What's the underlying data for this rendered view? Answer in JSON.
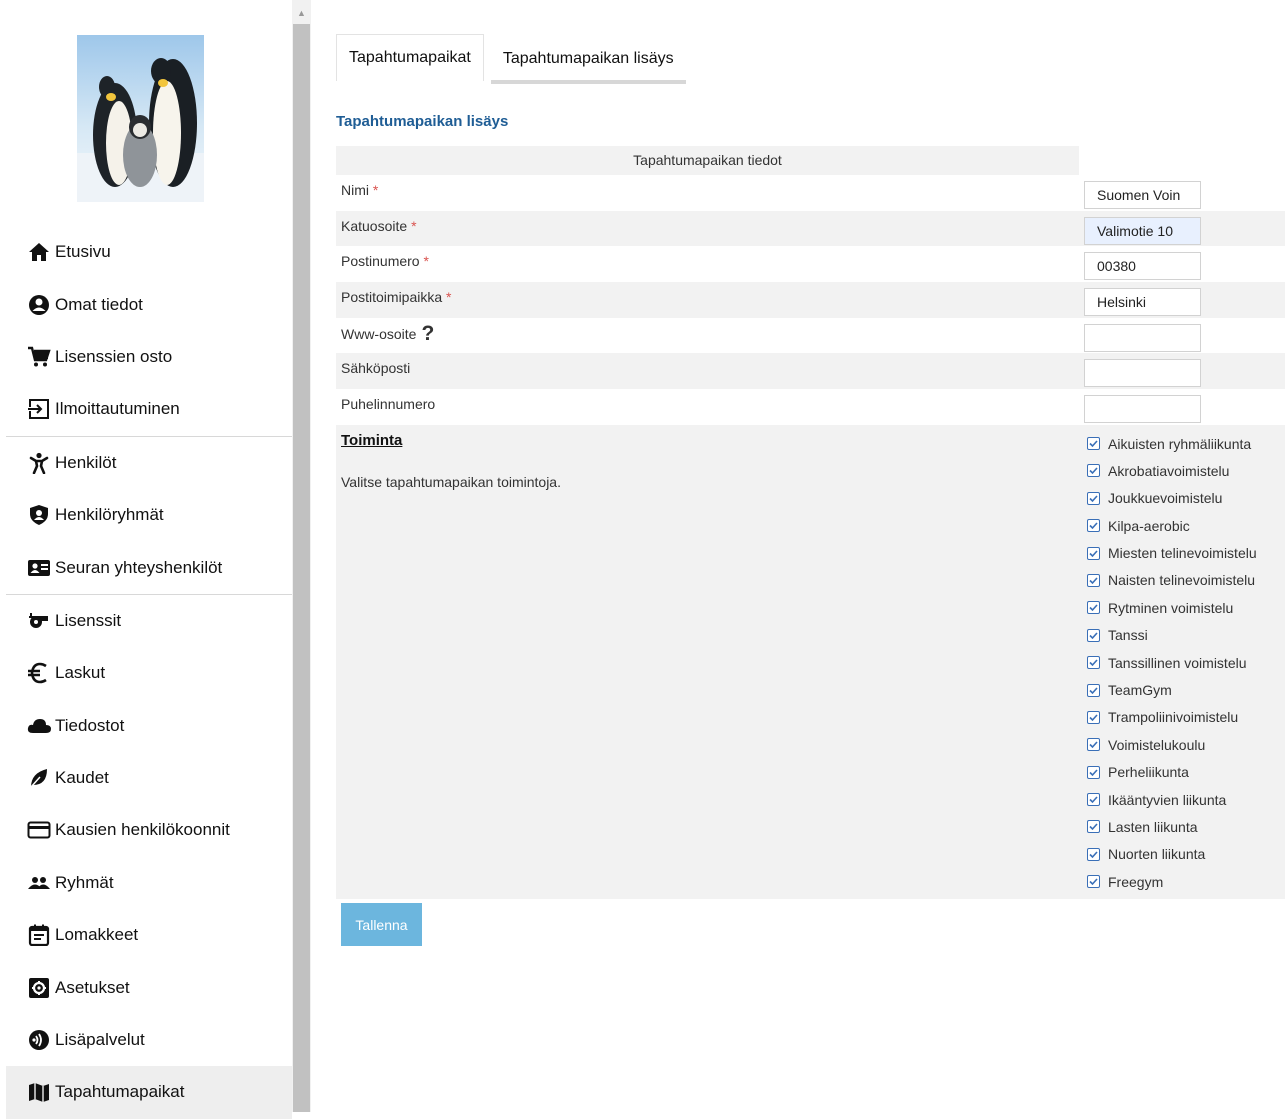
{
  "sidebar": {
    "logo_alt": "penguins",
    "items": [
      {
        "label": "Etusivu",
        "icon": "home-icon"
      },
      {
        "label": "Omat tiedot",
        "icon": "user-circle-icon"
      },
      {
        "label": "Lisenssien osto",
        "icon": "cart-icon"
      },
      {
        "label": "Ilmoittautuminen",
        "icon": "sign-in-icon"
      },
      {
        "label": "Henkilöt",
        "icon": "person-icon"
      },
      {
        "label": "Henkilöryhmät",
        "icon": "group-shield-icon"
      },
      {
        "label": "Seuran yhteyshenkilöt",
        "icon": "contact-card-icon"
      },
      {
        "label": "Lisenssit",
        "icon": "whistle-icon"
      },
      {
        "label": "Laskut",
        "icon": "euro-icon"
      },
      {
        "label": "Tiedostot",
        "icon": "cloud-icon"
      },
      {
        "label": "Kaudet",
        "icon": "leaf-icon"
      },
      {
        "label": "Kausien henkilökoonnit",
        "icon": "credit-card-icon"
      },
      {
        "label": "Ryhmät",
        "icon": "people-icon"
      },
      {
        "label": "Lomakkeet",
        "icon": "calendar-form-icon"
      },
      {
        "label": "Asetukset",
        "icon": "settings-icon"
      },
      {
        "label": "Lisäpalvelut",
        "icon": "addon-icon"
      },
      {
        "label": "Tapahtumapaikat",
        "icon": "map-icon"
      }
    ]
  },
  "tabs": [
    {
      "label": "Tapahtumapaikat"
    },
    {
      "label": "Tapahtumapaikan lisäys"
    }
  ],
  "form": {
    "section_title": "Tapahtumapaikan lisäys",
    "fieldset_title": "Tapahtumapaikan tiedot",
    "fields": [
      {
        "label": "Nimi",
        "required": "*",
        "value": "Suomen Voin"
      },
      {
        "label": "Katuosoite",
        "required": "*",
        "value": "Valimotie 10"
      },
      {
        "label": "Postinumero",
        "required": "*",
        "value": "00380"
      },
      {
        "label": "Postitoimipaikka",
        "required": "*",
        "value": "Helsinki"
      },
      {
        "label": "Www-osoite",
        "help": "?",
        "value": ""
      },
      {
        "label": "Sähköposti",
        "value": ""
      },
      {
        "label": "Puhelinnumero",
        "value": ""
      }
    ],
    "activities_heading": "Toiminta",
    "activities_description": "Valitse tapahtumapaikan toimintoja.",
    "activities": [
      "Aikuisten ryhmäliikunta",
      "Akrobatiavoimistelu",
      "Joukkuevoimistelu",
      "Kilpa-aerobic",
      "Miesten telinevoimistelu",
      "Naisten telinevoimistelu",
      "Rytminen voimistelu",
      "Tanssi",
      "Tanssillinen voimistelu",
      "TeamGym",
      "Trampoliinivoimistelu",
      "Voimistelukoulu",
      "Perheliikunta",
      "Ikääntyvien liikunta",
      "Lasten liikunta",
      "Nuorten liikunta",
      "Freegym"
    ],
    "save_label": "Tallenna"
  },
  "colors": {
    "accent_title": "#1f5d95",
    "required": "#d9534f",
    "save_button": "#6cb6de",
    "checkbox": "#3a6fb7"
  }
}
